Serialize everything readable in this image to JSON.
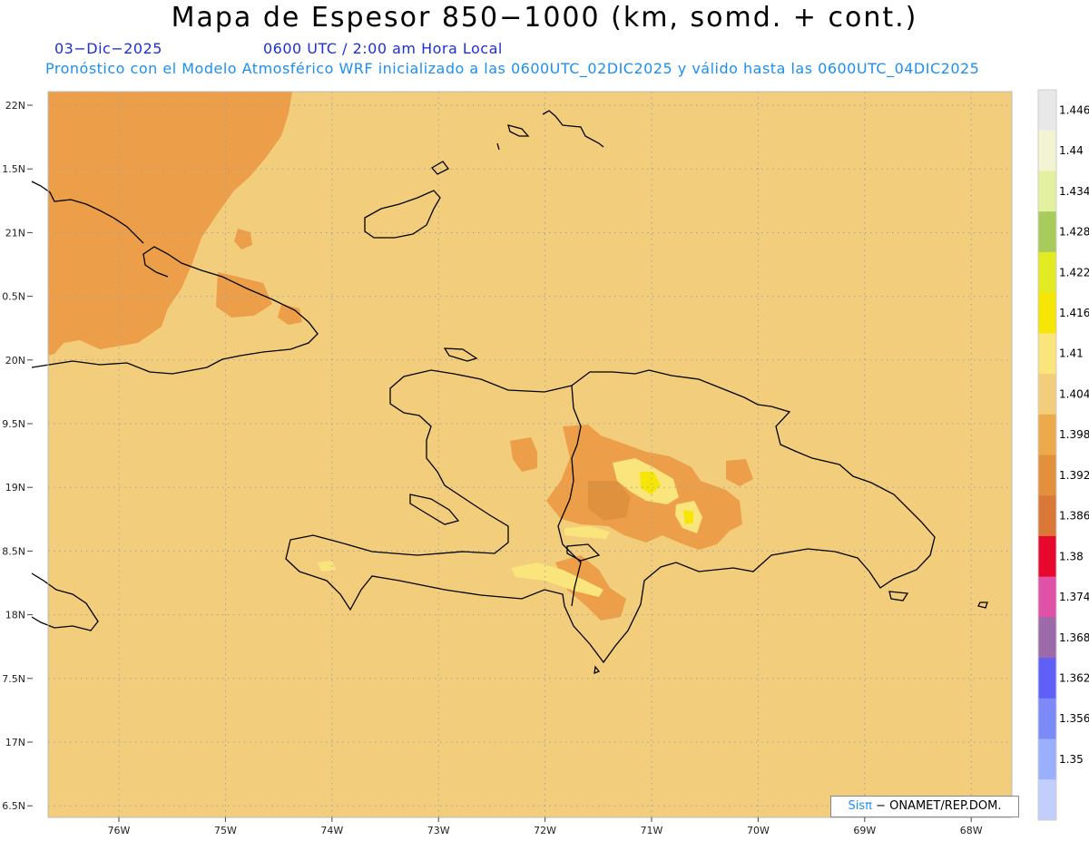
{
  "title": "Mapa de Espesor 850−1000 (km, somd. + cont.)",
  "date": "03−Dic−2025",
  "time": "0600 UTC / 2:00 am Hora Local",
  "info": "Pronóstico con el Modelo Atmosférico WRF inicializado a las 0600UTC_02DIC2025 y válido hasta las  0600UTC_04DIC2025",
  "credit": {
    "brand": "Sisπ",
    "text": "− ONAMET/REP.DOM."
  },
  "lat_labels": [
    "22N",
    "1.5N",
    "21N",
    "0.5N",
    "20N",
    "9.5N",
    "19N",
    "8.5N",
    "18N",
    "7.5N",
    "17N",
    "6.5N"
  ],
  "lon_labels": [
    "76W",
    "75W",
    "74W",
    "73W",
    "72W",
    "71W",
    "70W",
    "69W",
    "68W"
  ],
  "colorbar": {
    "labels": [
      "1.446",
      "1.44",
      "1.434",
      "1.428",
      "1.422",
      "1.416",
      "1.41",
      "1.404",
      "1.398",
      "1.392",
      "1.386",
      "1.38",
      "1.374",
      "1.368",
      "1.362",
      "1.356",
      "1.35"
    ],
    "colors": [
      "#e8e8e8",
      "#f2f4d4",
      "#e3f0a0",
      "#a8cc5c",
      "#e2ea22",
      "#f6e604",
      "#fae47c",
      "#f2ce7c",
      "#ecaa4a",
      "#e2903c",
      "#da7838",
      "#e8082e",
      "#e052a8",
      "#9c6aa8",
      "#6060f8",
      "#7c8af8",
      "#9ab0fc",
      "#c2cefc"
    ]
  },
  "palette": {
    "background_field": "#f2ce7c",
    "warm_region": "#ec9f48",
    "darker_orange": "#e0913e",
    "yellow": "#fae47c",
    "bright_yellow": "#f6e604",
    "coast": "#000000",
    "grid": "#a0a0a0"
  }
}
